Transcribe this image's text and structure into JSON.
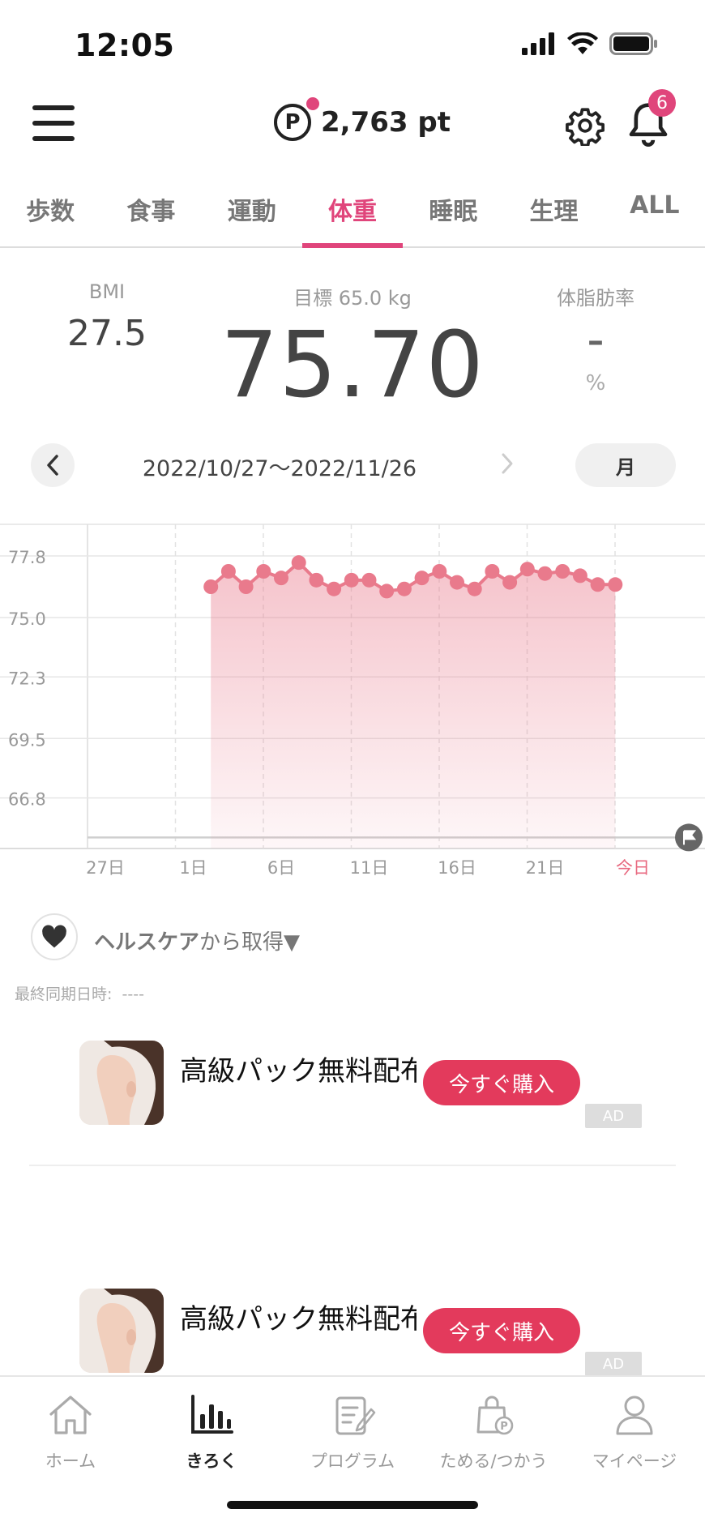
{
  "status_bar": {
    "time": "12:05"
  },
  "header": {
    "points": "2,763 pt",
    "points_symbol": "P",
    "notification_count": "6"
  },
  "tabs": [
    {
      "label": "歩数",
      "active": false
    },
    {
      "label": "食事",
      "active": false
    },
    {
      "label": "運動",
      "active": false
    },
    {
      "label": "体重",
      "active": true
    },
    {
      "label": "睡眠",
      "active": false
    },
    {
      "label": "生理",
      "active": false
    },
    {
      "label": "ALL",
      "active": false
    }
  ],
  "summary": {
    "bmi_label": "BMI",
    "bmi_value": "27.5",
    "goal_label": "目標 65.0 kg",
    "weight": "75.70",
    "fat_label": "体脂肪率",
    "fat_value": "–",
    "fat_unit": "%"
  },
  "date_nav": {
    "range": "2022/10/27〜2022/11/26",
    "period": "月"
  },
  "chart_data": {
    "type": "area",
    "ytick_labels": [
      "77.8",
      "75.0",
      "72.3",
      "69.5",
      "66.8"
    ],
    "ylim": [
      64.5,
      79.2
    ],
    "goal_value": 65.0,
    "xtick_labels": [
      "27日",
      "1日",
      "6日",
      "11日",
      "16日",
      "21日",
      "今日"
    ],
    "x_days": [
      "2022-11-03",
      "2022-11-04",
      "2022-11-05",
      "2022-11-06",
      "2022-11-07",
      "2022-11-08",
      "2022-11-09",
      "2022-11-10",
      "2022-11-11",
      "2022-11-12",
      "2022-11-13",
      "2022-11-14",
      "2022-11-15",
      "2022-11-16",
      "2022-11-17",
      "2022-11-18",
      "2022-11-19",
      "2022-11-20",
      "2022-11-21",
      "2022-11-22",
      "2022-11-23",
      "2022-11-24",
      "2022-11-25",
      "2022-11-26"
    ],
    "values": [
      76.4,
      77.1,
      76.4,
      77.1,
      76.8,
      77.5,
      76.7,
      76.3,
      76.7,
      76.7,
      76.2,
      76.3,
      76.8,
      77.1,
      76.6,
      76.3,
      77.1,
      76.6,
      77.2,
      77.0,
      77.1,
      76.9,
      76.5,
      76.5
    ],
    "grid": true,
    "today_color": "#e86a80",
    "series_color": "#e97a8c"
  },
  "health": {
    "link": "ヘルスケア",
    "link_suffix": "から取得▼",
    "sync_label": "最終同期日時:",
    "sync_value": "----"
  },
  "ads": [
    {
      "title": "高級パック無料配布",
      "button": "今すぐ購入",
      "badge": "AD"
    },
    {
      "title": "高級パック無料配布",
      "button": "今すぐ購入",
      "badge": "AD"
    }
  ],
  "bottom_nav": [
    {
      "label": "ホーム",
      "active": false
    },
    {
      "label": "きろく",
      "active": true
    },
    {
      "label": "プログラム",
      "active": false
    },
    {
      "label": "ためる/つかう",
      "active": false
    },
    {
      "label": "マイページ",
      "active": false
    }
  ]
}
